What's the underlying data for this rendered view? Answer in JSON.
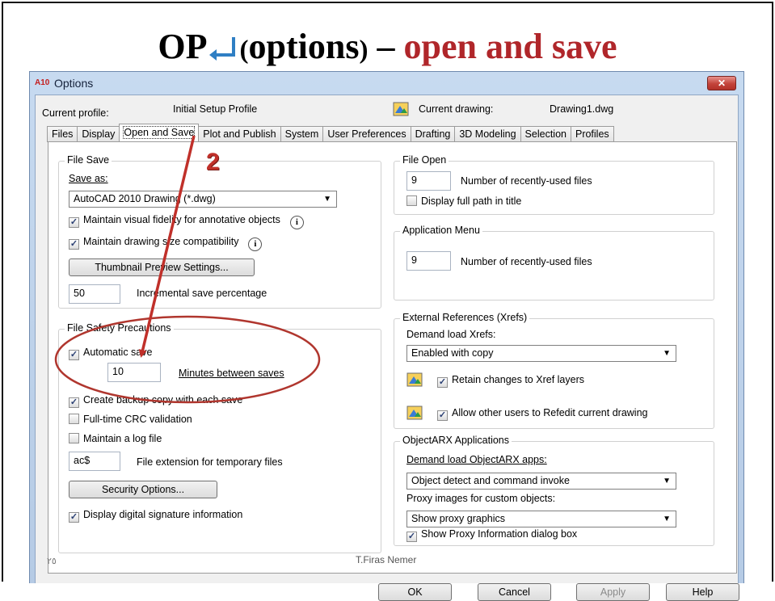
{
  "slide": {
    "title_code": "OP",
    "title_open_paren": "(",
    "title_word": "options",
    "title_close_paren": ")",
    "title_dash": "–",
    "title_accent": "open and save",
    "slide_number": "٢٥",
    "author": "T.Firas Nemer",
    "annotation_number": "2",
    "accent_color": "#b0262a"
  },
  "dialog": {
    "title": "Options",
    "app_logo": "A10",
    "close_label": "✕",
    "current_profile_label": "Current profile:",
    "current_profile_value": "Initial Setup Profile",
    "current_drawing_label": "Current drawing:",
    "current_drawing_value": "Drawing1.dwg",
    "tabs": [
      "Files",
      "Display",
      "Open and Save",
      "Plot and Publish",
      "System",
      "User Preferences",
      "Drafting",
      "3D Modeling",
      "Selection",
      "Profiles"
    ],
    "active_tab": "Open and Save"
  },
  "file_save": {
    "legend": "File Save",
    "save_as_label": "Save as:",
    "save_as_value": "AutoCAD 2010 Drawing (*.dwg)",
    "fidelity_label": "Maintain visual fidelity for annotative objects",
    "fidelity_checked": true,
    "size_compat_label": "Maintain drawing size compatibility",
    "size_compat_checked": true,
    "thumbnail_button": "Thumbnail Preview Settings...",
    "incremental_value": "50",
    "incremental_label": "Incremental save percentage",
    "info_icon": "i"
  },
  "file_safety": {
    "legend": "File Safety Precautions",
    "automatic_save_label": "Automatic save",
    "automatic_save_checked": true,
    "minutes_value": "10",
    "minutes_label": "Minutes between saves",
    "backup_label": "Create backup copy with each save",
    "backup_checked": true,
    "crc_label": "Full-time CRC validation",
    "crc_checked": false,
    "log_label": "Maintain a log file",
    "log_checked": false,
    "temp_ext_value": "ac$",
    "temp_ext_label": "File extension for temporary files",
    "security_button": "Security Options...",
    "digital_sig_label": "Display digital signature information",
    "digital_sig_checked": true
  },
  "file_open": {
    "legend": "File Open",
    "recent_value": "9",
    "recent_label": "Number of recently-used files",
    "full_path_label": "Display full path in title",
    "full_path_checked": false
  },
  "app_menu": {
    "legend": "Application Menu",
    "recent_value": "9",
    "recent_label": "Number of recently-used files"
  },
  "xrefs": {
    "legend": "External References (Xrefs)",
    "demand_label": "Demand load Xrefs:",
    "demand_value": "Enabled with copy",
    "retain_label": "Retain changes to Xref layers",
    "retain_checked": true,
    "refedit_label": "Allow other users to Refedit current drawing",
    "refedit_checked": true
  },
  "arx": {
    "legend": "ObjectARX Applications",
    "demand_label": "Demand load ObjectARX apps:",
    "demand_value": "Object detect and command invoke",
    "proxy_label": "Proxy images for custom objects:",
    "proxy_value": "Show proxy graphics",
    "show_proxy_label": "Show Proxy Information dialog box",
    "show_proxy_checked": true
  },
  "buttons": {
    "ok": "OK",
    "cancel": "Cancel",
    "apply": "Apply",
    "help": "Help"
  },
  "icons": {
    "dropdown": "▼",
    "check": "✓"
  }
}
